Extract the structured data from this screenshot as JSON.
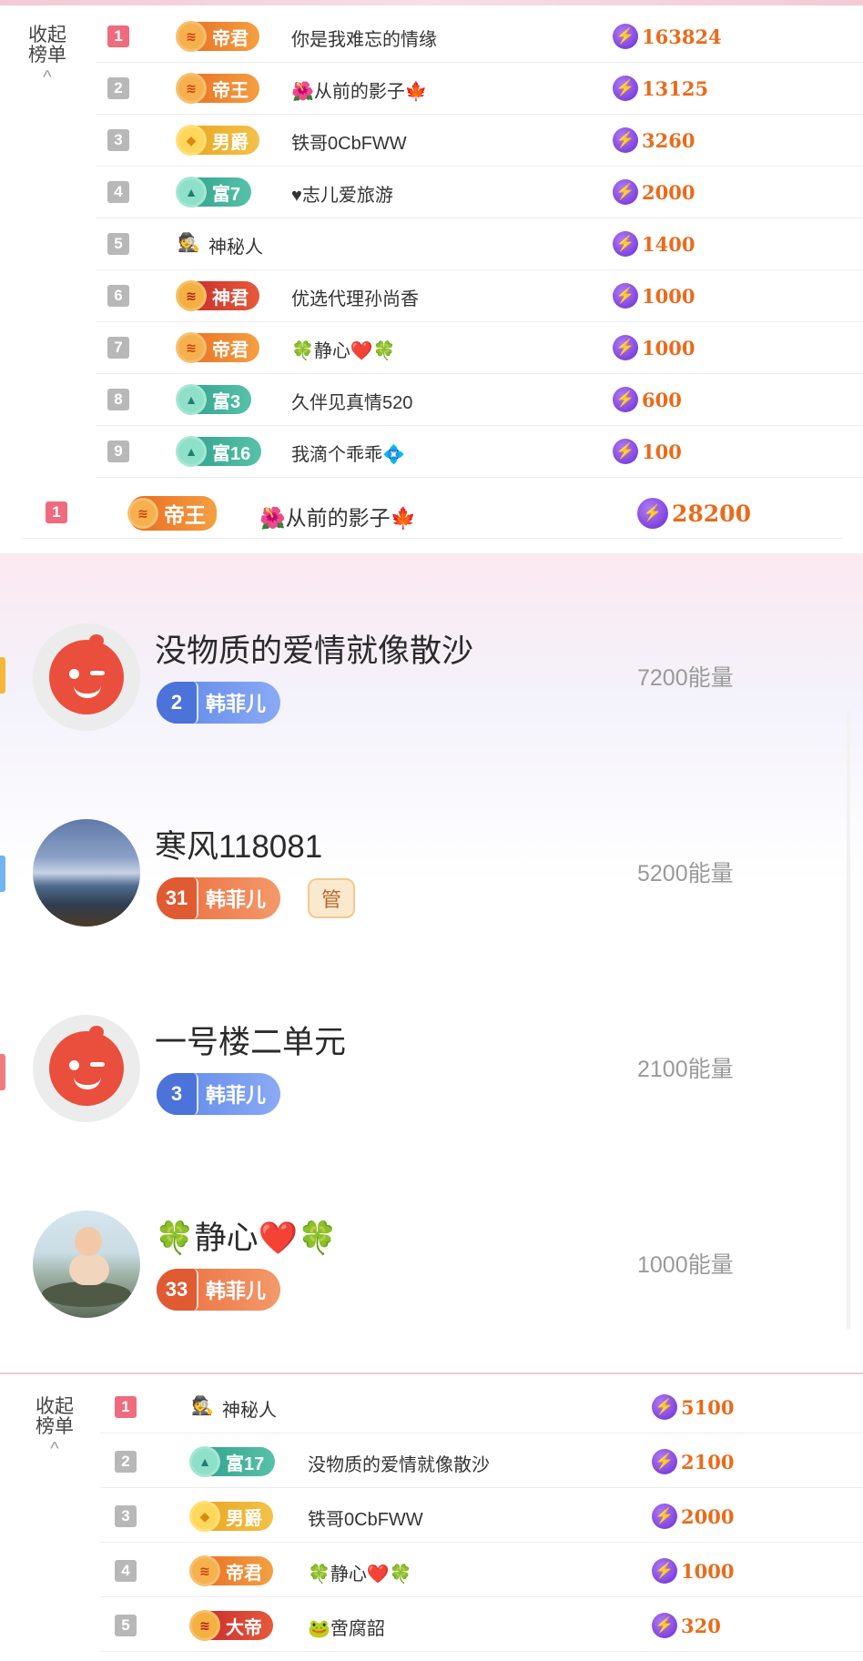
{
  "panel1": {
    "collapse_label": "收起\n榜单",
    "collapse_chevron": "^",
    "rows": [
      {
        "rank": "1",
        "badge": "帝君",
        "badge_style": "orange",
        "name": "你是我难忘的情缘",
        "score": "163824"
      },
      {
        "rank": "2",
        "badge": "帝王",
        "badge_style": "orange",
        "name": "🌺从前的影子🍁",
        "score": "13125"
      },
      {
        "rank": "3",
        "badge": "男爵",
        "badge_style": "gold",
        "name": "铁哥0CbFWW",
        "score": "3260"
      },
      {
        "rank": "4",
        "badge": "富7",
        "badge_style": "teal",
        "name": "♥志儿爱旅游",
        "score": "2000"
      },
      {
        "rank": "5",
        "badge": "",
        "badge_style": "none",
        "icon": "🕵",
        "name": "神秘人",
        "score": "1400"
      },
      {
        "rank": "6",
        "badge": "神君",
        "badge_style": "red",
        "name": "优选代理孙尚香",
        "score": "1000"
      },
      {
        "rank": "7",
        "badge": "帝君",
        "badge_style": "orange",
        "name": "🍀静心❤️🍀",
        "score": "1000"
      },
      {
        "rank": "8",
        "badge": "富3",
        "badge_style": "teal",
        "name": "久伴见真情520",
        "score": "600"
      },
      {
        "rank": "9",
        "badge": "富16",
        "badge_style": "teal",
        "name": "我滴个乖乖💠",
        "score": "100"
      }
    ]
  },
  "single_row": {
    "rank": "1",
    "badge": "帝王",
    "badge_style": "orange",
    "name": "🌺从前的影子🍁",
    "score": "28200"
  },
  "fans": [
    {
      "name": "没物质的爱情就像散沙",
      "level": "2",
      "club": "韩菲儿",
      "badge_color": "blue",
      "energy": "7200能量",
      "avatar": "face",
      "manager": false
    },
    {
      "name": "寒风118081",
      "level": "31",
      "club": "韩菲儿",
      "badge_color": "orange",
      "energy": "5200能量",
      "avatar": "mountain",
      "manager": true,
      "manager_label": "管"
    },
    {
      "name": "一号楼二单元",
      "level": "3",
      "club": "韩菲儿",
      "badge_color": "blue",
      "energy": "2100能量",
      "avatar": "face",
      "manager": false
    },
    {
      "name": "🍀静心❤️🍀",
      "level": "33",
      "club": "韩菲儿",
      "badge_color": "orange",
      "energy": "1000能量",
      "avatar": "child",
      "manager": false
    }
  ],
  "panel2": {
    "collapse_label": "收起\n榜单",
    "collapse_chevron": "^",
    "rows": [
      {
        "rank": "1",
        "badge": "",
        "badge_style": "none",
        "icon": "🕵",
        "name": "神秘人",
        "score": "5100"
      },
      {
        "rank": "2",
        "badge": "富17",
        "badge_style": "teal",
        "name": "没物质的爱情就像散沙",
        "score": "2100"
      },
      {
        "rank": "3",
        "badge": "男爵",
        "badge_style": "gold",
        "name": "铁哥0CbFWW",
        "score": "2000"
      },
      {
        "rank": "4",
        "badge": "帝君",
        "badge_style": "orange",
        "name": "🍀静心❤️🍀",
        "score": "1000"
      },
      {
        "rank": "5",
        "badge": "大帝",
        "badge_style": "red",
        "name": "🐸啻腐韶",
        "score": "320"
      }
    ]
  },
  "icons": {
    "score": "lightning-bolt-icon",
    "collapse": "chevron-up-icon"
  },
  "colors": {
    "score": "#e96b1b",
    "rank_top": "#ef6b7e",
    "rank_default": "#b8b8b8",
    "bolt": "#6a2bd4"
  }
}
